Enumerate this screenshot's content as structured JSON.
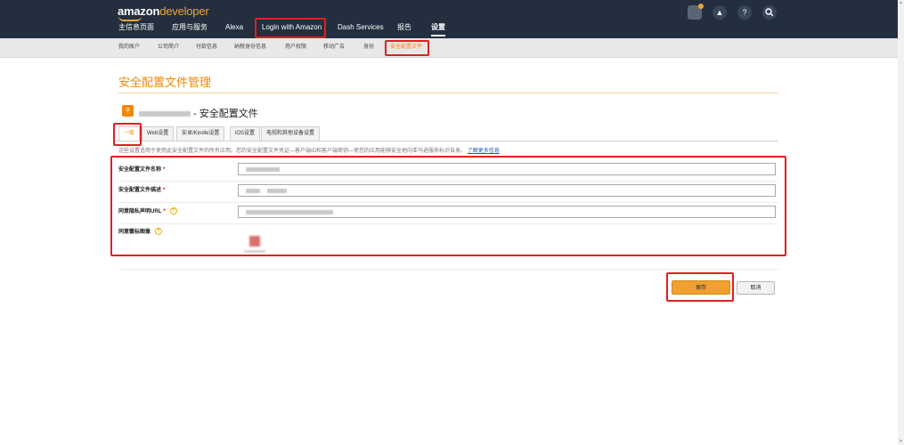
{
  "header": {
    "logo_brand": "amazon",
    "logo_suffix": "developer",
    "nav": [
      {
        "label": "主信息页面"
      },
      {
        "label": "应用与服务"
      },
      {
        "label": "Alexa"
      },
      {
        "label": "Login with Amazon"
      },
      {
        "label": "Dash Services"
      },
      {
        "label": "报告"
      },
      {
        "label": "设置"
      }
    ],
    "active_nav": "设置",
    "icons": [
      "avatar-icon",
      "bell-icon",
      "help-icon",
      "search-icon"
    ],
    "help_glyph": "?",
    "search_glyph": "⚲",
    "bell_glyph": "🔔"
  },
  "subnav": {
    "items": [
      {
        "label": "我的账户"
      },
      {
        "label": "公司简介"
      },
      {
        "label": "付款信息"
      },
      {
        "label": "纳税身份信息"
      },
      {
        "label": "用户权限"
      },
      {
        "label": "移动广告"
      },
      {
        "label": "身份"
      },
      {
        "label": "安全配置文件"
      }
    ],
    "active": "安全配置文件"
  },
  "page": {
    "title": "安全配置文件管理",
    "profile_heading_suffix": "- 安全配置文件",
    "tabs": [
      {
        "label": "一般"
      },
      {
        "label": "Web设置"
      },
      {
        "label": "安卓/Kindle设置"
      },
      {
        "label": "iOS设置"
      },
      {
        "label": "电视和其他设备设置"
      }
    ],
    "active_tab": "一般",
    "description": "这些设置适用于使用此安全配置文件的所有应用。您的安全配置文件凭证—客户端ID和客户端密钥—使您的应用能够安全地向亚马逊服务标识自身。",
    "learn_more": "了解更多信息"
  },
  "form": {
    "fields": [
      {
        "label": "安全配置文件名称",
        "required": "*",
        "help": false
      },
      {
        "label": "安全配置文件描述",
        "required": "*",
        "help": false
      },
      {
        "label": "同意隐私声明URL",
        "required": "*",
        "help": true
      },
      {
        "label": "同意徽标图像",
        "required": "",
        "help": true
      }
    ],
    "help_glyph": "?"
  },
  "actions": {
    "save_label": "保存",
    "cancel_label": "取消"
  },
  "colors": {
    "accent": "#f08804",
    "topbar": "#232f3e",
    "highlight_box": "#e02020"
  }
}
